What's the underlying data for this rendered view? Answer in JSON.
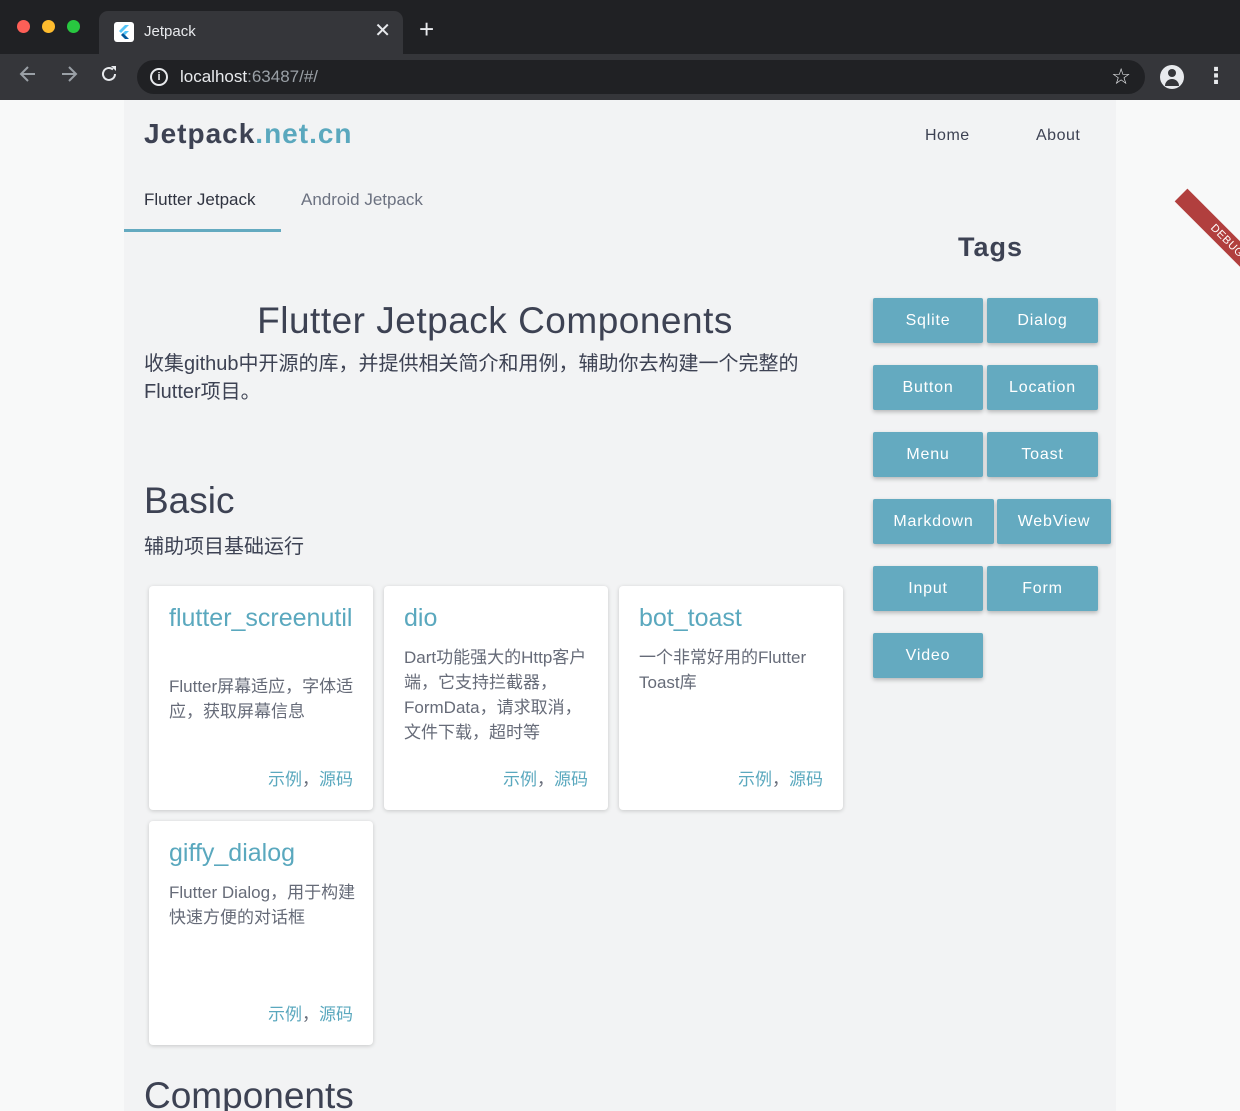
{
  "browser": {
    "tab_title": "Jetpack",
    "close_glyph": "✕",
    "new_tab_glyph": "+",
    "url_host": "localhost",
    "url_rest": ":63487/#/",
    "icons": {
      "back": "arrow-left-icon",
      "forward": "arrow-right-icon",
      "reload": "reload-icon",
      "info": "info-icon",
      "star": "star-icon",
      "profile": "profile-icon",
      "menu": "menu-dots-icon",
      "favicon": "flutter-icon"
    }
  },
  "header": {
    "brand_main": "Jetpack",
    "brand_domain": ".net.cn",
    "nav": {
      "home": "Home",
      "about": "About"
    }
  },
  "tabs": {
    "flutter": "Flutter Jetpack",
    "android": "Android Jetpack"
  },
  "hero": {
    "title": "Flutter Jetpack Components",
    "description": "收集github中开源的库，并提供相关简介和用例，辅助你去构建一个完整的Flutter项目。"
  },
  "sections": {
    "basic": {
      "title": "Basic",
      "subtitle": "辅助项目基础运行"
    },
    "components": {
      "title": "Components"
    }
  },
  "cards": [
    {
      "title": "flutter_screenutil",
      "description": "Flutter屏幕适应，字体适应，获取屏幕信息",
      "example": "示例",
      "separator": "，",
      "source": "源码"
    },
    {
      "title": "dio",
      "description": "Dart功能强大的Http客户端，它支持拦截器，FormData，请求取消，文件下载，超时等",
      "example": "示例",
      "separator": "，",
      "source": "源码"
    },
    {
      "title": "bot_toast",
      "description": "一个非常好用的Flutter Toast库",
      "example": "示例",
      "separator": "，",
      "source": "源码"
    },
    {
      "title": "giffy_dialog",
      "description": "Flutter Dialog，用于构建快速方便的对话框",
      "example": "示例",
      "separator": "，",
      "source": "源码"
    }
  ],
  "tags": {
    "title": "Tags",
    "items": [
      "Sqlite",
      "Dialog",
      "Button",
      "Location",
      "Menu",
      "Toast",
      "Markdown",
      "WebView",
      "Input",
      "Form",
      "Video"
    ]
  },
  "debug_banner": "DEBUG",
  "colors": {
    "accent": "#64aac0",
    "brand_domain": "#5aa8be",
    "text_dark": "#3d4253",
    "debug": "#b13f3e"
  }
}
